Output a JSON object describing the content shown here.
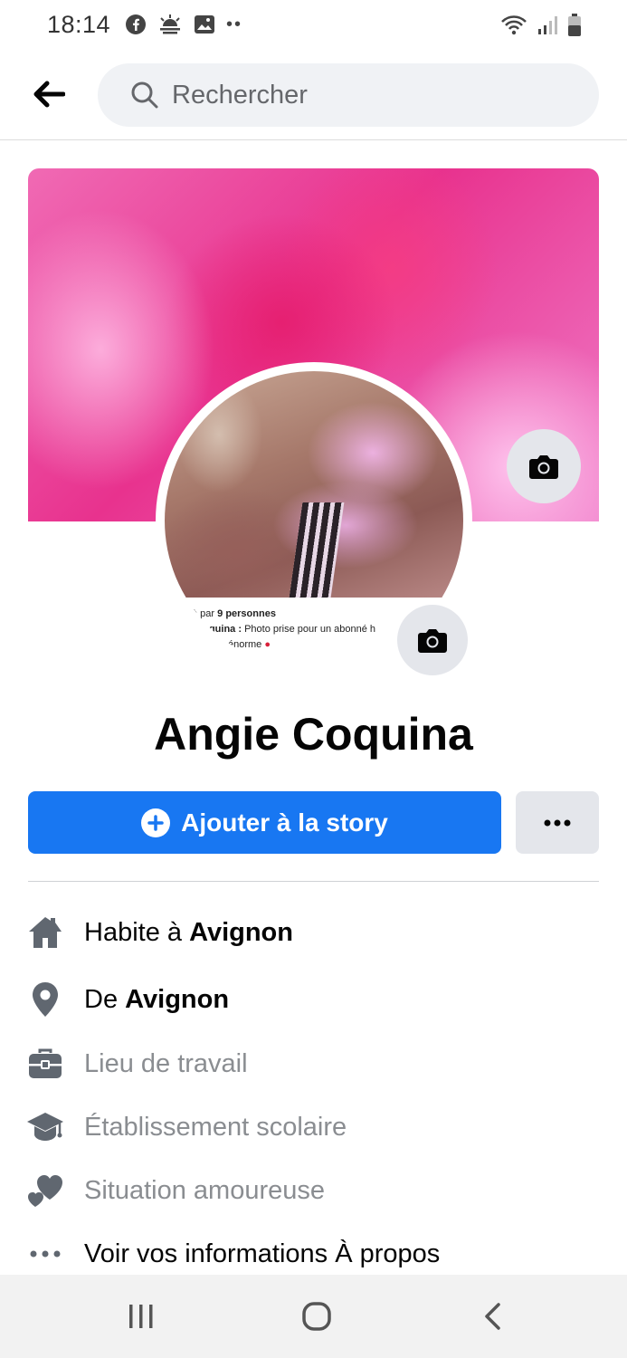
{
  "status_bar": {
    "time": "18:14"
  },
  "search": {
    "placeholder": "Rechercher"
  },
  "profile": {
    "name": "Angie Coquina",
    "photo_caption": {
      "line1_prefix": "à par ",
      "line1_bold": "9 personnes",
      "line2_bold": "ecoquina :",
      "line2_rest": " Photo prise pour un abonné h",
      "line3": "énorme"
    }
  },
  "actions": {
    "add_story_label": "Ajouter à la story",
    "more_label": "•••"
  },
  "details": {
    "lives_in": {
      "prefix": "Habite à ",
      "value": "Avignon"
    },
    "from": {
      "prefix": "De ",
      "value": "Avignon"
    },
    "workplace": "Lieu de travail",
    "school": "Établissement scolaire",
    "relationship": "Situation amoureuse",
    "about": "Voir vos informations À propos"
  },
  "colors": {
    "accent": "#1877f2",
    "muted_text": "#8a8d91",
    "icon_grey": "#606770"
  }
}
